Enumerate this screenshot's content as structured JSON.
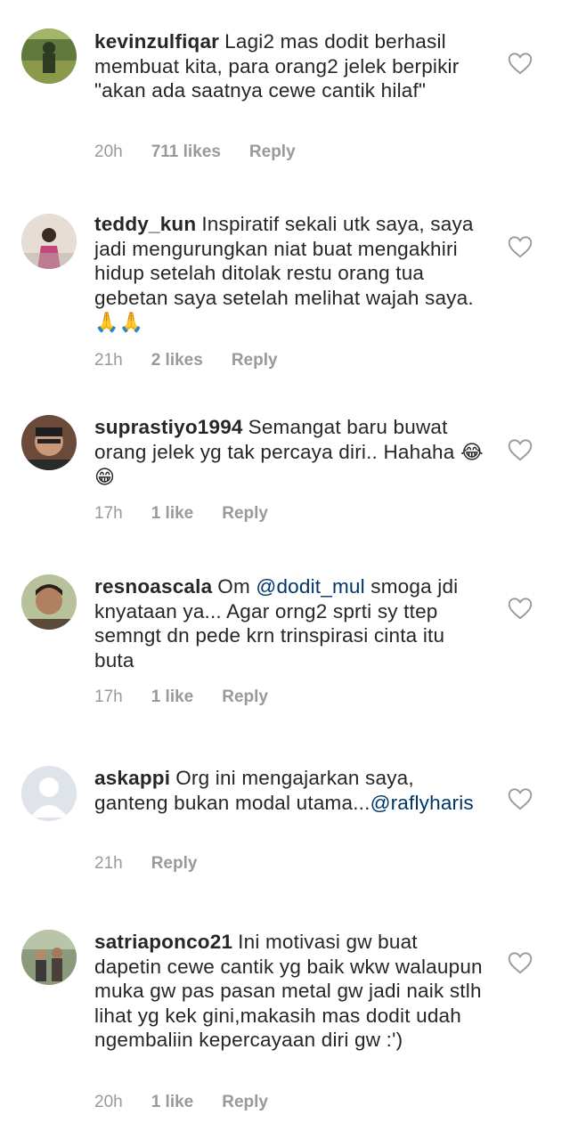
{
  "comments": [
    {
      "username": "kevinzulfiqar",
      "text": "Lagi2 mas dodit berhasil membuat kita, para orang2 jelek berpikir \"akan ada saatnya cewe cantik hilaf\"",
      "time": "20h",
      "likes": "711 likes",
      "reply": "Reply",
      "avatar_colors": [
        "#5f7a3a",
        "#2e3a22"
      ]
    },
    {
      "username": "teddy_kun",
      "text": "Inspiratif sekali utk saya, saya jadi mengurungkan niat buat mengakhiri hidup setelah ditolak restu orang tua gebetan saya setelah melihat wajah saya.",
      "emoji": "🙏🙏",
      "time": "21h",
      "likes": "2 likes",
      "reply": "Reply",
      "avatar_colors": [
        "#d9d0c6",
        "#c2477a"
      ]
    },
    {
      "username": "suprastiyo1994",
      "text": "Semangat baru buwat orang jelek yg tak percaya diri.. Hahaha",
      "emoji": "😂😁",
      "time": "17h",
      "likes": "1 like",
      "reply": "Reply",
      "avatar_colors": [
        "#8a4b3a",
        "#1f1f1f"
      ]
    },
    {
      "username": "resnoascala",
      "text_before": "Om",
      "mention": "@dodit_mul",
      "text_after": "smoga jdi knyataan ya... Agar orng2 sprti sy ttep semngt dn pede krn trinspirasi cinta itu buta",
      "time": "17h",
      "likes": "1 like",
      "reply": "Reply",
      "avatar_colors": [
        "#a8b58a",
        "#4a3a2a"
      ]
    },
    {
      "username": "askappi",
      "text": "Org ini mengajarkan saya, ganteng bukan modal utama...",
      "mention": "@raflyharis",
      "time": "21h",
      "reply": "Reply",
      "avatar_colors": [
        "#dfe3ea",
        "#ffffff"
      ]
    },
    {
      "username": "satriaponco21",
      "text": "Ini motivasi gw buat dapetin  cewe cantik yg baik wkw walaupun muka gw pas pasan metal gw jadi naik stlh lihat yg kek gini,makasih mas dodit udah ngembaliin kepercayaan diri gw :')",
      "time": "20h",
      "likes": "1 like",
      "reply": "Reply",
      "avatar_colors": [
        "#7a8a6a",
        "#3a3a3a"
      ]
    }
  ],
  "icons": {
    "like": "heart-outline-icon"
  },
  "colors": {
    "text": "#262626",
    "meta": "#999999",
    "mention": "#003569"
  }
}
